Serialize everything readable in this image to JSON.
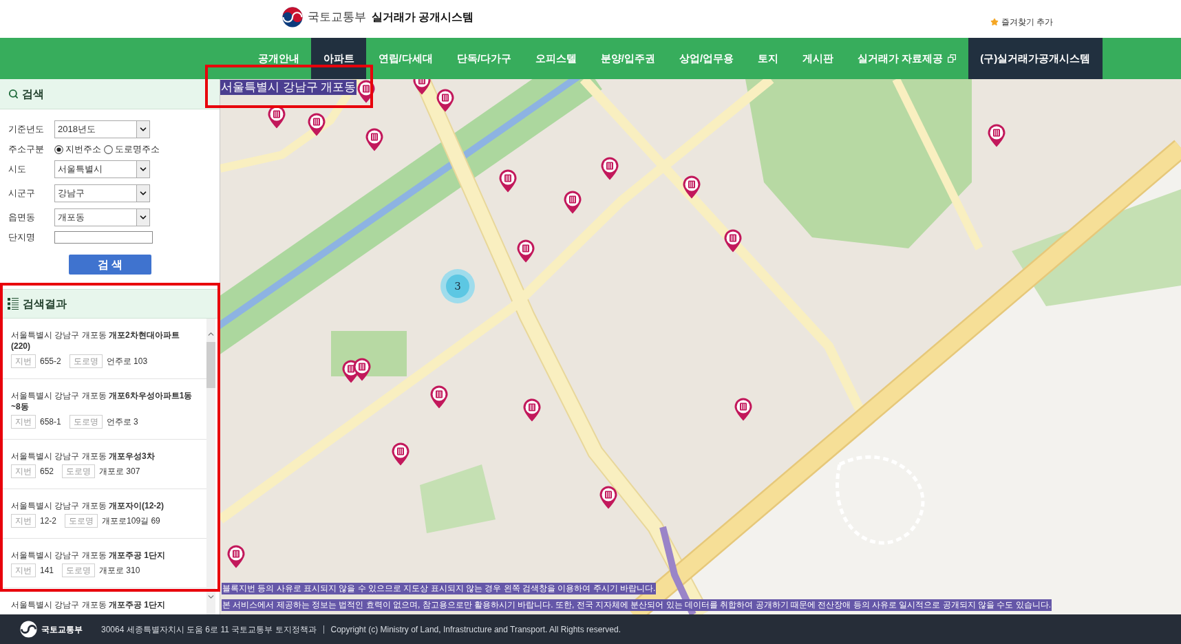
{
  "header": {
    "ministry": "국토교통부",
    "system_title": "실거래가 공개시스템",
    "bookmark": "즐겨찾기 추가"
  },
  "nav": [
    {
      "label": "공개안내",
      "selected": false,
      "external": false
    },
    {
      "label": "아파트",
      "selected": true,
      "external": false
    },
    {
      "label": "연립/다세대",
      "selected": false,
      "external": false
    },
    {
      "label": "단독/다가구",
      "selected": false,
      "external": false
    },
    {
      "label": "오피스텔",
      "selected": false,
      "external": false
    },
    {
      "label": "분양/입주권",
      "selected": false,
      "external": false
    },
    {
      "label": "상업/업무용",
      "selected": false,
      "external": false
    },
    {
      "label": "토지",
      "selected": false,
      "external": false
    },
    {
      "label": "게시판",
      "selected": false,
      "external": false
    },
    {
      "label": "실거래가 자료제공",
      "selected": false,
      "external": true
    }
  ],
  "legacy_link": "(구)실거래가공개시스템",
  "search_panel": {
    "title": "검색",
    "fields": [
      {
        "kind": "select",
        "label": "기준년도",
        "value": "2018년도"
      },
      {
        "kind": "radio",
        "label": "주소구분",
        "options": [
          {
            "label": "지번주소",
            "selected": true
          },
          {
            "label": "도로명주소",
            "selected": false
          }
        ]
      },
      {
        "kind": "select",
        "label": "시도",
        "value": "서울특별시"
      },
      {
        "kind": "select",
        "label": "시군구",
        "value": "강남구"
      },
      {
        "kind": "select",
        "label": "읍면동",
        "value": "개포동"
      },
      {
        "kind": "text",
        "label": "단지명"
      }
    ],
    "button": "검 색"
  },
  "results": {
    "title": "검색결과",
    "highlighted": true,
    "items": [
      {
        "address": "서울특별시 강남구 개포동 **개포2차현대아파트(220)**",
        "lot_label": "지번",
        "lot": "655-2",
        "road_label": "도로명",
        "road": "언주로 103"
      },
      {
        "address": "서울특별시 강남구 개포동 **개포6차우성아파트1동~8동**",
        "lot_label": "지번",
        "lot": "658-1",
        "road_label": "도로명",
        "road": "언주로 3"
      },
      {
        "address": "서울특별시 강남구 개포동 **개포우성3차**",
        "lot_label": "지번",
        "lot": "652",
        "road_label": "도로명",
        "road": "개포로 307"
      },
      {
        "address": "서울특별시 강남구 개포동 **개포자이(12-2)**",
        "lot_label": "지번",
        "lot": "12-2",
        "road_label": "도로명",
        "road": "개포로109길 69"
      },
      {
        "address": "서울특별시 강남구 개포동 **개포주공 1단지**",
        "lot_label": "지번",
        "lot": "141",
        "road_label": "도로명",
        "road": "개포로 310"
      },
      {
        "address": "서울특별시 강남구 개포동 **개포주공 1단지**"
      }
    ]
  },
  "map": {
    "location_label": {
      "text": "서울특별시 강남구 개포동",
      "highlighted": true
    },
    "cluster": "3",
    "notices": [
      "블록지번 등의 사유로 표시되지 않을 수 있으므로 지도상 표시되지 않는 경우 왼쪽 검색창을 이용하여 주시기 바랍니다.",
      "본 서비스에서 제공하는 정보는 법적인 효력이 없으며, 참고용으로만 활용하시기 바랍니다. 또한, 전국 지자체에 분산되어 있는 데이터를 취합하여 공개하기 때문에 전산장애 등의 사유로 일시적으로 공개되지 않을 수도 있습니다."
    ]
  },
  "footer": {
    "ministry": "국토교통부",
    "address": "30064 세종특별자치시 도움 6로 11 국토교통부 토지정책과",
    "copyright": "Copyright (c) Ministry of Land, Infrastructure and Transport. All Rights reserved."
  }
}
